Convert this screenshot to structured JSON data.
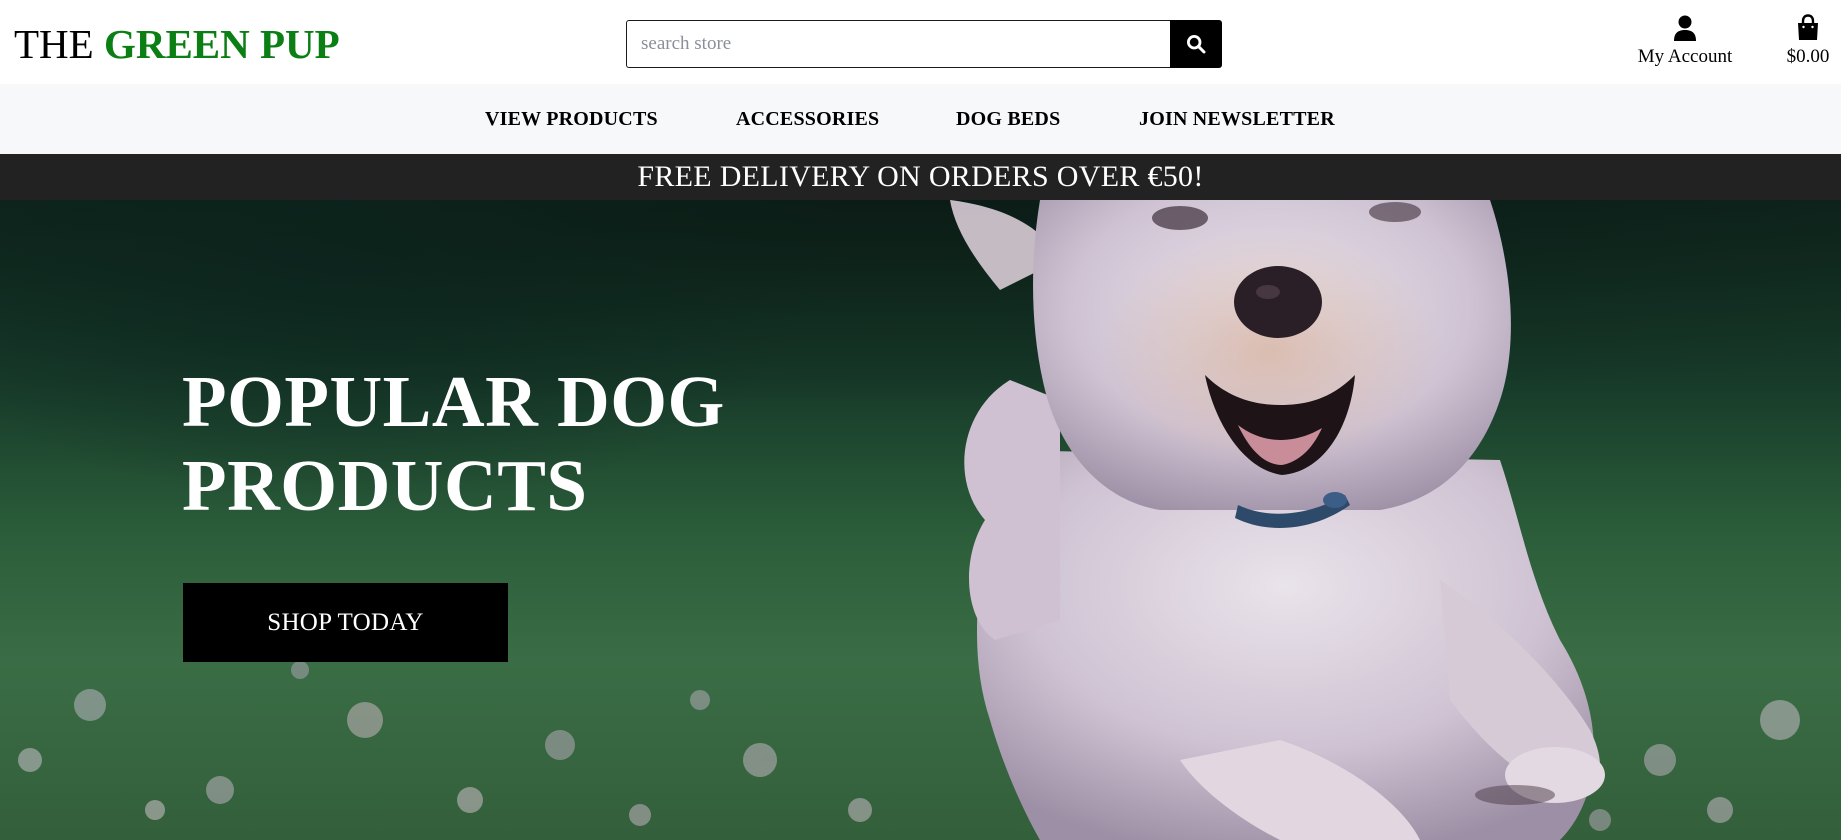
{
  "header": {
    "logo": {
      "prefix": "THE",
      "brand": "GREEN PUP"
    },
    "search": {
      "placeholder": "search store",
      "value": ""
    },
    "account_label": "My Account",
    "bag_total": "$0.00"
  },
  "nav": {
    "items": [
      {
        "label": "VIEW PRODUCTS"
      },
      {
        "label": "ACCESSORIES"
      },
      {
        "label": "DOG BEDS"
      },
      {
        "label": "JOIN NEWSLETTER"
      }
    ]
  },
  "banner": {
    "text": "FREE DELIVERY ON ORDERS OVER €50!"
  },
  "hero": {
    "title_line1": "POPULAR DOG",
    "title_line2": "PRODUCTS",
    "cta_label": "SHOP TODAY"
  },
  "icons": {
    "search": "search-icon",
    "account": "user-icon",
    "bag": "shopping-bag-icon"
  },
  "colors": {
    "brand_green": "#0b7f14",
    "banner_bg": "#222222",
    "nav_bg": "#f7f8fa",
    "cta_bg": "#000000"
  }
}
